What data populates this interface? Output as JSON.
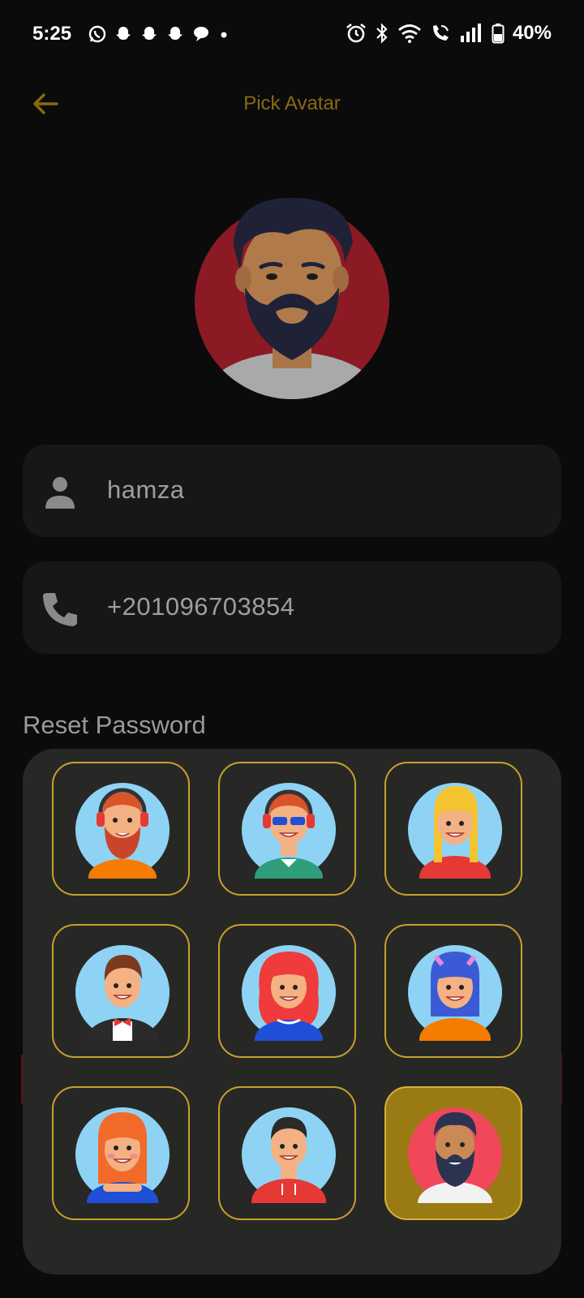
{
  "status_bar": {
    "time": "5:25",
    "battery": "40%",
    "left_icons": [
      "whatsapp-icon",
      "snapchat-icon",
      "snapchat-icon",
      "snapchat-icon",
      "chat-bubble-icon",
      "dot-icon"
    ],
    "right_icons": [
      "alarm-icon",
      "bluetooth-icon",
      "wifi-icon",
      "wifi-calling-icon",
      "signal-icon",
      "battery-icon"
    ]
  },
  "app_bar": {
    "title": "Pick Avatar"
  },
  "profile": {
    "name": "hamza",
    "phone": "+201096703854",
    "reset_password": "Reset Password"
  },
  "avatar_picker": {
    "selected_index": 8,
    "avatars": [
      {
        "name": "bearded-man-headphones",
        "bg": "#8fd3f4",
        "shirt": "#f57c00",
        "hair": "#d9532b",
        "skin": "#f4b183"
      },
      {
        "name": "man-sunglasses-headphones",
        "bg": "#8fd3f4",
        "shirt": "#2e9e7a",
        "hair": "#d9532b",
        "skin": "#f4b183"
      },
      {
        "name": "blonde-woman",
        "bg": "#8fd3f4",
        "shirt": "#e53935",
        "hair": "#f4c430",
        "skin": "#f4b183"
      },
      {
        "name": "man-bowtie",
        "bg": "#8fd3f4",
        "shirt": "#2b2b2b",
        "hair": "#7a3b1e",
        "skin": "#f4b183"
      },
      {
        "name": "redhead-woman",
        "bg": "#8fd3f4",
        "shirt": "#1e4fd6",
        "hair": "#ef3b3b",
        "skin": "#f4b183"
      },
      {
        "name": "blue-hair-girl-cat-ears",
        "bg": "#8fd3f4",
        "shirt": "#f57c00",
        "hair": "#3b5bd6",
        "skin": "#f4b183"
      },
      {
        "name": "ginger-woman",
        "bg": "#8fd3f4",
        "shirt": "#1e4fd6",
        "hair": "#f26a2a",
        "skin": "#f4b183"
      },
      {
        "name": "man-red-hoodie",
        "bg": "#8fd3f4",
        "shirt": "#e53935",
        "hair": "#2b2b2b",
        "skin": "#f4b183"
      },
      {
        "name": "bearded-man-dark-hair",
        "bg": "#f0485a",
        "shirt": "#f2f2f2",
        "hair": "#2c3350",
        "skin": "#c98a55"
      }
    ]
  },
  "colors": {
    "background": "#0b0b0b",
    "accent": "#c9a02c",
    "selected_fill": "#9a7a12",
    "field_bg": "#171717",
    "sheet_bg": "#272826",
    "big_avatar_bg": "#8b1a24"
  }
}
